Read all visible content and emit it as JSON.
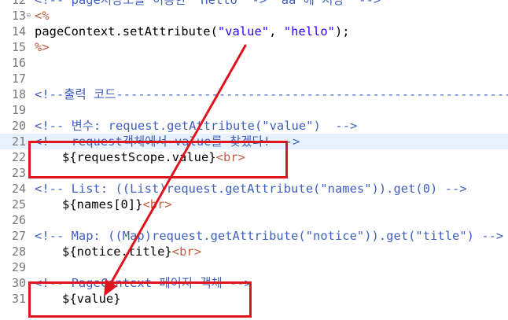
{
  "editor": {
    "lines": [
      {
        "num": "12",
        "fold": "",
        "highlight": false,
        "indent": false,
        "segments": [
          {
            "cls": "c-com",
            "text": "<!-- page저장소를 이용한  Hello  ->  aa 에 저장  -->"
          }
        ]
      },
      {
        "num": "13",
        "fold": "⊖",
        "highlight": false,
        "indent": false,
        "segments": [
          {
            "cls": "c-scr",
            "text": "<%"
          }
        ]
      },
      {
        "num": "14",
        "fold": "",
        "highlight": false,
        "indent": false,
        "segments": [
          {
            "cls": "c-def",
            "text": "pageContext.setAttribute("
          },
          {
            "cls": "c-str",
            "text": "\"value\""
          },
          {
            "cls": "c-def",
            "text": ", "
          },
          {
            "cls": "c-str",
            "text": "\"hello\""
          },
          {
            "cls": "c-def",
            "text": ");"
          }
        ]
      },
      {
        "num": "15",
        "fold": "",
        "highlight": false,
        "indent": false,
        "segments": [
          {
            "cls": "c-scr",
            "text": "%>"
          }
        ]
      },
      {
        "num": "16",
        "fold": "",
        "highlight": false,
        "indent": false,
        "segments": []
      },
      {
        "num": "17",
        "fold": "",
        "highlight": false,
        "indent": false,
        "segments": []
      },
      {
        "num": "18",
        "fold": "",
        "highlight": false,
        "indent": false,
        "segments": [
          {
            "cls": "c-com",
            "text": "<!--출력 코드------------------------------------------------------"
          }
        ]
      },
      {
        "num": "19",
        "fold": "",
        "highlight": false,
        "indent": false,
        "segments": []
      },
      {
        "num": "20",
        "fold": "",
        "highlight": false,
        "indent": false,
        "segments": [
          {
            "cls": "c-com",
            "text": "<!-- 변수: request.getAttribute(\"value\")  -->"
          }
        ]
      },
      {
        "num": "21",
        "fold": "",
        "highlight": true,
        "indent": false,
        "segments": [
          {
            "cls": "c-com",
            "text": "<!-- request객체에서 value를 찾겠다! -->"
          }
        ]
      },
      {
        "num": "22",
        "fold": "",
        "highlight": false,
        "indent": true,
        "segments": [
          {
            "cls": "c-txt",
            "text": "${requestScope.value}"
          },
          {
            "cls": "c-tag",
            "text": "<br>"
          }
        ]
      },
      {
        "num": "23",
        "fold": "",
        "highlight": false,
        "indent": false,
        "segments": []
      },
      {
        "num": "24",
        "fold": "",
        "highlight": false,
        "indent": false,
        "segments": [
          {
            "cls": "c-com",
            "text": "<!-- List: ((List)request.getAttribute(\"names\")).get(0) -->"
          }
        ]
      },
      {
        "num": "25",
        "fold": "",
        "highlight": false,
        "indent": true,
        "segments": [
          {
            "cls": "c-txt",
            "text": "${names[0]}"
          },
          {
            "cls": "c-tag",
            "text": "<br>"
          }
        ]
      },
      {
        "num": "26",
        "fold": "",
        "highlight": false,
        "indent": false,
        "segments": []
      },
      {
        "num": "27",
        "fold": "",
        "highlight": false,
        "indent": false,
        "segments": [
          {
            "cls": "c-com",
            "text": "<!-- Map: ((Map)request.getAttribute(\"notice\")).get(\"title\") -->"
          }
        ]
      },
      {
        "num": "28",
        "fold": "",
        "highlight": false,
        "indent": true,
        "segments": [
          {
            "cls": "c-txt",
            "text": "${notice.title}"
          },
          {
            "cls": "c-tag",
            "text": "<br>"
          }
        ]
      },
      {
        "num": "29",
        "fold": "",
        "highlight": false,
        "indent": false,
        "segments": []
      },
      {
        "num": "30",
        "fold": "",
        "highlight": false,
        "indent": false,
        "segments": [
          {
            "cls": "c-com",
            "text": "<!-- PageContext 페이지 객체 -->"
          }
        ]
      },
      {
        "num": "31",
        "fold": "",
        "highlight": false,
        "indent": true,
        "segments": [
          {
            "cls": "c-txt",
            "text": "${value}"
          }
        ]
      }
    ]
  },
  "annotation": {
    "color": "#e0141e"
  }
}
